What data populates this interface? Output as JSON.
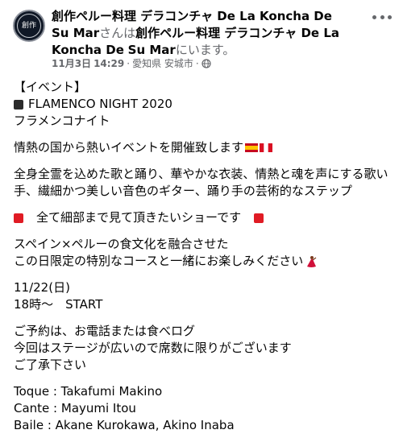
{
  "post": {
    "author": "創作ペルー料理 デラコンチャ De La Koncha De Su Mar",
    "checkin_suffix": "さんは",
    "location_page_line1": "創作ペルー料理 デラコンチャ De La Koncha De",
    "location_page_line2": "Su Mar",
    "checkin_end": "にいます。",
    "date": "11月3日",
    "time": "14:29",
    "separator": "·",
    "place": "愛知県 安城市",
    "avatar_text": "創作",
    "icons": {
      "more": "more-options-icon",
      "audience": "globe-icon"
    }
  },
  "body": {
    "l1": "【イベント】",
    "l2": "FLAMENCO NIGHT 2020",
    "l3": "フラメンコナイト",
    "l4": "情熱の国から熱いイベントを開催致します",
    "l5": "全身全霊を込めた歌と踊り、華やかな衣装、情熱と魂を声にする歌い",
    "l6": "手、繊細かつ美しい音色のギター、踊り手の芸術的なステップ",
    "l7": "全て細部まで見て頂きたいショーです",
    "l8": "スペイン×ペルーの食文化を融合させた",
    "l9": "この日限定の特別なコースと一緒にお楽しみください",
    "l10": "11/22(日)",
    "l11": "18時～　START",
    "l12": "ご予約は、お電話または食べログ",
    "l13": "今回はステージが広いので席数に限りがございます",
    "l14": "ご了承下さい",
    "l15": "Toque : Takafumi Makino",
    "l16": "Cante : Mayumi Itou",
    "l17": "Baile : Akane Kurokawa, Akino Inaba",
    "emoji": {
      "square_black": "black-square-icon",
      "square_red": "red-square-icon",
      "flag_es": "spain-flag-icon",
      "flag_pe": "peru-flag-icon",
      "dancer": "dancer-icon"
    }
  }
}
